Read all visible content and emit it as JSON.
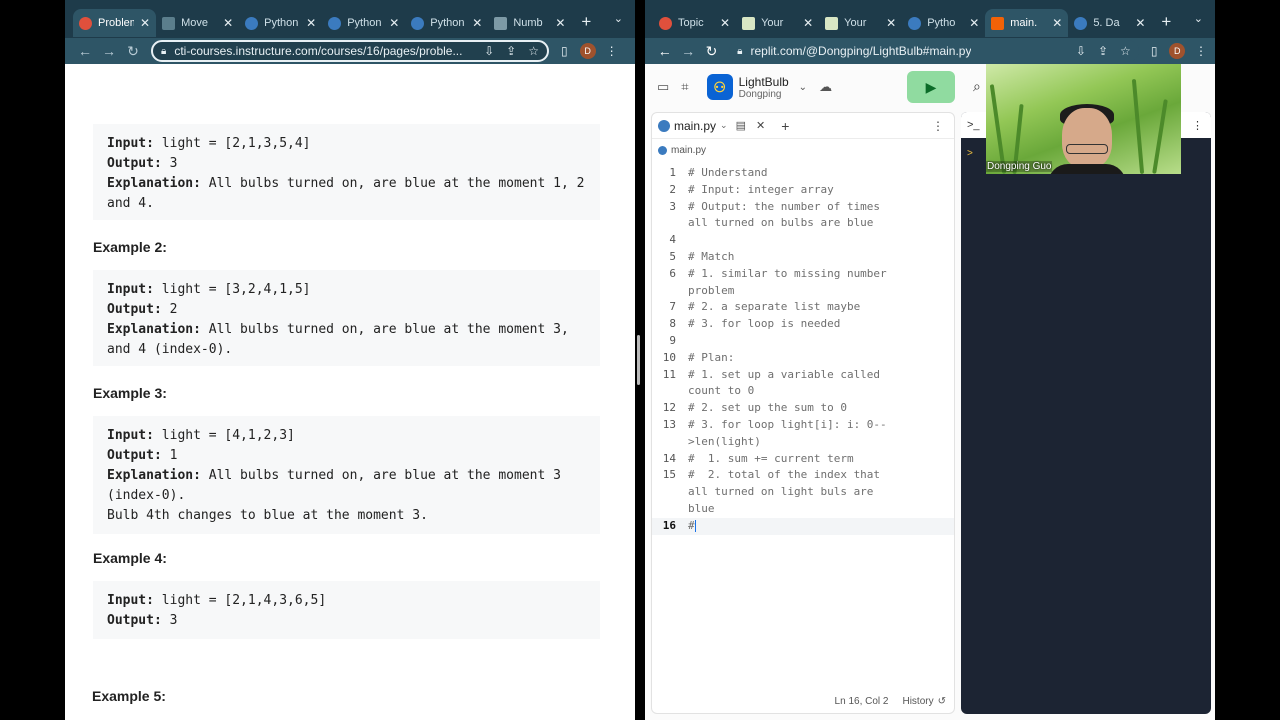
{
  "left_window": {
    "tabs": [
      {
        "label": "Problem",
        "active": true,
        "icon": "canvas-icon"
      },
      {
        "label": "Move",
        "icon": "bookmark-icon"
      },
      {
        "label": "Python",
        "icon": "python-icon"
      },
      {
        "label": "Python",
        "icon": "python-icon"
      },
      {
        "label": "Python",
        "icon": "python-icon"
      },
      {
        "label": "Numb",
        "icon": "generic-icon"
      }
    ],
    "url": "cti-courses.instructure.com/courses/16/pages/proble...",
    "profile_initial": "D",
    "examples": [
      {
        "input_label": "Input:",
        "input_value": " light = [2,1,3,5,4]",
        "output_label": "Output:",
        "output_value": " 3",
        "explanation_label": "Explanation:",
        "explanation_value": " All bulbs turned on, are blue at the moment 1, 2 and 4."
      },
      {
        "heading": "Example 2:",
        "input_label": "Input:",
        "input_value": " light = [3,2,4,1,5]",
        "output_label": "Output:",
        "output_value": " 2",
        "explanation_label": "Explanation:",
        "explanation_value": " All bulbs turned on, are blue at the moment 3, and 4 (index-0)."
      },
      {
        "heading": "Example 3:",
        "input_label": "Input:",
        "input_value": " light = [4,1,2,3]",
        "output_label": "Output:",
        "output_value": " 1",
        "explanation_label": "Explanation:",
        "explanation_value": " All bulbs turned on, are blue at the moment 3 (index-0).",
        "extra": "Bulb 4th changes to blue at the moment 3."
      },
      {
        "heading": "Example 4:",
        "input_label": "Input:",
        "input_value": " light = [2,1,4,3,6,5]",
        "output_label": "Output:",
        "output_value": " 3"
      }
    ],
    "example5_heading": "Example 5:"
  },
  "right_window": {
    "tabs": [
      {
        "label": "Topic",
        "icon": "canvas-icon"
      },
      {
        "label": "Your",
        "icon": "check-icon"
      },
      {
        "label": "Your",
        "icon": "check-icon"
      },
      {
        "label": "Pytho",
        "icon": "python-icon"
      },
      {
        "label": "main.",
        "active": true,
        "icon": "replit-icon"
      },
      {
        "label": "5. Da",
        "icon": "python-icon"
      }
    ],
    "url": "replit.com/@Dongping/LightBulb#main.py",
    "profile_initial": "D",
    "project_name": "LightBulb",
    "project_owner": "Dongping",
    "file_tab": "main.py",
    "breadcrumb": "main.py",
    "code_lines": [
      {
        "n": "1",
        "text": "# Understand"
      },
      {
        "n": "2",
        "text": "# Input: integer array"
      },
      {
        "n": "3",
        "text": "# Output: the number of times all turned on bulbs are blue"
      },
      {
        "n": "4",
        "text": ""
      },
      {
        "n": "5",
        "text": "# Match"
      },
      {
        "n": "6",
        "text": "# 1. similar to missing number problem"
      },
      {
        "n": "7",
        "text": "# 2. a separate list maybe"
      },
      {
        "n": "8",
        "text": "# 3. for loop is needed"
      },
      {
        "n": "9",
        "text": ""
      },
      {
        "n": "10",
        "text": "# Plan:"
      },
      {
        "n": "11",
        "text": "# 1. set up a variable called count to 0"
      },
      {
        "n": "12",
        "text": "# 2. set up the sum to 0"
      },
      {
        "n": "13",
        "text": "# 3. for loop light[i]: i: 0-->len(light)"
      },
      {
        "n": "14",
        "text": "#  1. sum += current term"
      },
      {
        "n": "15",
        "text": "#  2. total of the index that all turned on light buls are blue"
      },
      {
        "n": "16",
        "text": "#",
        "current": true
      }
    ],
    "status_position": "Ln 16, Col 2",
    "status_history": "History",
    "console_prompt": ">"
  },
  "webcam": {
    "name": "Dongping Guo"
  }
}
